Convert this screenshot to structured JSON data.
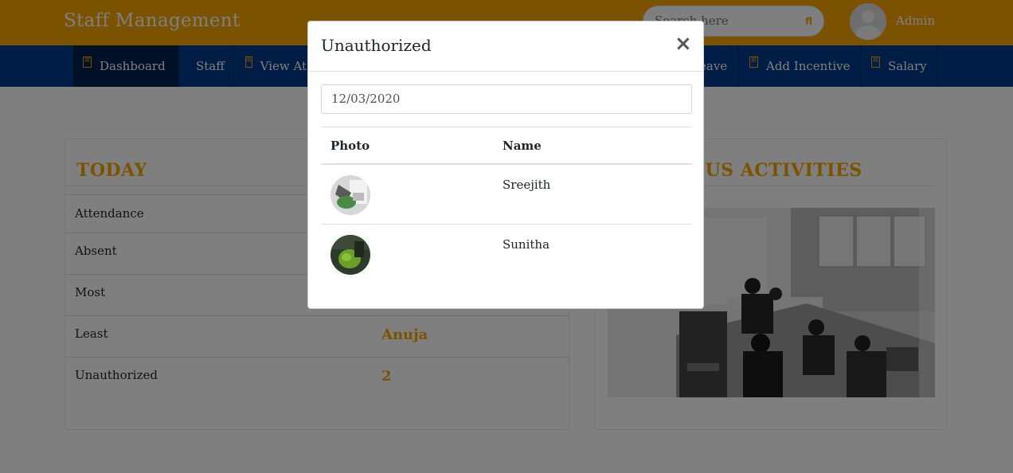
{
  "header": {
    "brand": "Staff Management",
    "search_placeholder": "Search here",
    "user_name": "Admin",
    "accent_color": "#f7a500"
  },
  "nav": {
    "items": [
      {
        "label": "Dashboard",
        "icon": "document-icon",
        "active": true
      },
      {
        "label": "Staff",
        "icon": "none"
      },
      {
        "label": "View At",
        "icon": "document-icon"
      },
      {
        "label": "eave",
        "icon": "none"
      },
      {
        "label": "Add Incentive",
        "icon": "document-icon"
      },
      {
        "label": "Salary",
        "icon": "document-icon"
      }
    ]
  },
  "today": {
    "title": "TODAY",
    "rows": [
      {
        "label": "Attendance",
        "value": ""
      },
      {
        "label": "Absent",
        "value": ""
      },
      {
        "label": "Most",
        "value": ""
      },
      {
        "label": "Least",
        "value": "Anuja"
      },
      {
        "label": "Unauthorized",
        "value": "2"
      }
    ]
  },
  "activities": {
    "title": "IOUS ACTIVITIES"
  },
  "modal": {
    "title": "Unauthorized",
    "close_glyph": "×",
    "date": "12/03/2020",
    "columns": [
      "Photo",
      "Name"
    ],
    "rows": [
      {
        "name": "Sreejith"
      },
      {
        "name": "Sunitha"
      }
    ]
  }
}
